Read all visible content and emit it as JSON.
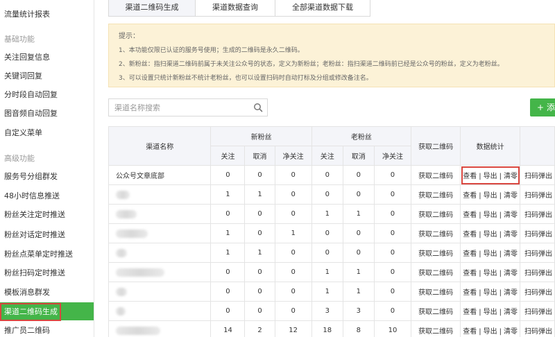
{
  "sidebar": {
    "items": [
      {
        "label": "流量统计报表",
        "type": "item"
      },
      {
        "label": "基础功能",
        "type": "section"
      },
      {
        "label": "关注回复信息",
        "type": "item"
      },
      {
        "label": "关键词回复",
        "type": "item"
      },
      {
        "label": "分时段自动回复",
        "type": "item"
      },
      {
        "label": "图音频自动回复",
        "type": "item"
      },
      {
        "label": "自定义菜单",
        "type": "item"
      },
      {
        "label": "高级功能",
        "type": "section"
      },
      {
        "label": "服务号分组群发",
        "type": "item"
      },
      {
        "label": "48小时信息推送",
        "type": "item"
      },
      {
        "label": "粉丝关注定时推送",
        "type": "item"
      },
      {
        "label": "粉丝对话定时推送",
        "type": "item"
      },
      {
        "label": "粉丝点菜单定时推送",
        "type": "item"
      },
      {
        "label": "粉丝扫码定时推送",
        "type": "item"
      },
      {
        "label": "模板消息群发",
        "type": "item"
      },
      {
        "label": "渠道二维码生成",
        "type": "active"
      },
      {
        "label": "推广员二维码",
        "type": "item"
      }
    ]
  },
  "tabs": [
    "渠道二维码生成",
    "渠道数据查询",
    "全部渠道数据下载"
  ],
  "notice": {
    "title": "提示：",
    "lines": [
      "1、本功能仅限已认证的服务号使用；生成的二维码是永久二维码。",
      "2、新粉丝：指扫渠道二维码前属于未关注公众号的状态，定义为新粉丝；老粉丝：指扫渠道二维码前已经是公众号的粉丝，定义为老粉丝。",
      "3、可以设置只统计新粉丝不统计老粉丝，也可以设置扫码时自动打标及分组或修改备注名。"
    ]
  },
  "search": {
    "placeholder": "渠道名称搜索"
  },
  "add_button": {
    "label": "+ 添"
  },
  "table": {
    "headers": {
      "name": "渠道名称",
      "new_group": "新粉丝",
      "old_group": "老粉丝",
      "get_qr": "获取二维码",
      "stats": "数据统计",
      "follow": "关注",
      "cancel": "取消",
      "net": "净关注"
    },
    "action_label": "获取二维码",
    "stat_links": {
      "view": "查看",
      "export": "导出",
      "clear": "清零",
      "sep": "|"
    },
    "extra_label": "扫码弹出",
    "rows": [
      {
        "name": "公众号文章底部",
        "blurred": false,
        "new": [
          "0",
          "0",
          "0"
        ],
        "old": [
          "0",
          "0",
          "0"
        ],
        "highlight": true
      },
      {
        "name": "",
        "blurred": true,
        "blur_w": 20,
        "new": [
          "1",
          "1",
          "0"
        ],
        "old": [
          "0",
          "0",
          "0"
        ],
        "highlight": false
      },
      {
        "name": "",
        "blurred": true,
        "blur_w": 30,
        "new": [
          "0",
          "0",
          "0"
        ],
        "old": [
          "1",
          "1",
          "0"
        ],
        "highlight": false
      },
      {
        "name": "",
        "blurred": true,
        "blur_w": 46,
        "new": [
          "1",
          "0",
          "1"
        ],
        "old": [
          "0",
          "0",
          "0"
        ],
        "highlight": false
      },
      {
        "name": "",
        "blurred": true,
        "blur_w": 16,
        "new": [
          "1",
          "1",
          "0"
        ],
        "old": [
          "0",
          "0",
          "0"
        ],
        "highlight": false
      },
      {
        "name": "",
        "blurred": true,
        "blur_w": 70,
        "new": [
          "0",
          "0",
          "0"
        ],
        "old": [
          "1",
          "1",
          "0"
        ],
        "highlight": false
      },
      {
        "name": "",
        "blurred": true,
        "blur_w": 16,
        "new": [
          "0",
          "0",
          "0"
        ],
        "old": [
          "1",
          "1",
          "0"
        ],
        "highlight": false
      },
      {
        "name": "",
        "blurred": true,
        "blur_w": 14,
        "new": [
          "0",
          "0",
          "0"
        ],
        "old": [
          "3",
          "3",
          "0"
        ],
        "highlight": false
      },
      {
        "name": "",
        "blurred": true,
        "blur_w": 64,
        "new": [
          "14",
          "2",
          "12"
        ],
        "old": [
          "18",
          "8",
          "10"
        ],
        "highlight": false
      }
    ]
  },
  "colors": {
    "brand_green": "#44b549",
    "highlight_red": "#d9463f",
    "notice_bg": "#fcf2d7"
  }
}
